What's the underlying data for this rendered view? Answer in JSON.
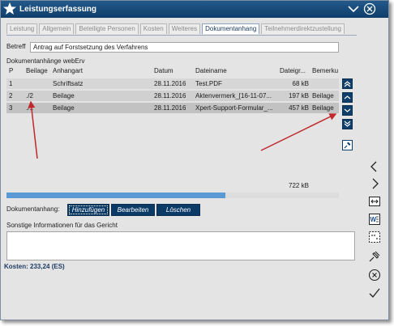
{
  "window": {
    "title": "Leistungserfassung"
  },
  "tabs": [
    {
      "label": "Leistung",
      "active": false
    },
    {
      "label": "Allgemein",
      "active": false
    },
    {
      "label": "Beteiligte Personen",
      "active": false
    },
    {
      "label": "Kosten",
      "active": false
    },
    {
      "label": "Weiteres",
      "active": false
    },
    {
      "label": "Dokumentanhang",
      "active": true
    },
    {
      "label": "Teilnehmerdirektzustellung",
      "active": false
    }
  ],
  "betreff": {
    "label": "Betreff",
    "value": "Antrag auf Forstsetzung des Verfahrens"
  },
  "attachments": {
    "section_title": "Dokumentanhänge webErv",
    "columns": [
      "P",
      "Beilage",
      "Anhangart",
      "Datum",
      "Dateiname",
      "Dateigr...",
      "Bemerku"
    ],
    "rows": [
      {
        "p": "1",
        "beilage": "",
        "anhangart": "Schriftsatz",
        "datum": "28.11.2016",
        "dateiname": "Test.PDF",
        "groesse": "68 kB",
        "bemerkung": ""
      },
      {
        "p": "2",
        "beilage": "./2",
        "anhangart": "Beilage",
        "datum": "28.11.2016",
        "dateiname": "Aktenvermerk_[16-11-07...",
        "groesse": "197 kB",
        "bemerkung": "Beilage"
      },
      {
        "p": "3",
        "beilage": "./1",
        "anhangart": "Beilage",
        "datum": "28.11.2016",
        "dateiname": "Xpert-Support-Formular_...",
        "groesse": "457 kB",
        "bemerkung": "Beilage"
      }
    ],
    "total_size": "722 kB"
  },
  "dokumentanhang": {
    "label": "Dokumentanhang:",
    "buttons": {
      "add": "Hinzufügen",
      "edit": "Bearbeiten",
      "delete": "Löschen"
    }
  },
  "notes": {
    "label": "Sonstige Informationen für das Gericht",
    "value": ""
  },
  "costs": {
    "text": "Kosten: 233,24 (ES)"
  },
  "colors": {
    "titlebar": "#0f3e6b",
    "button": "#0c3a66",
    "scroll_thumb": "#5a9ad4",
    "annotation_arrow": "#c0282c"
  },
  "icons": {
    "title": "star-app-icon",
    "window": [
      "collapse-chevron-icon",
      "close-circle-icon"
    ],
    "grid_side": [
      "move-top-icon",
      "move-up-icon",
      "move-down-icon",
      "move-bottom-icon",
      "pin-icon"
    ],
    "vertical_toolbar": [
      "chevron-left-icon",
      "chevron-right-icon",
      "resize-icon",
      "word-icon",
      "dots-icon",
      "pin-icon",
      "cancel-icon",
      "confirm-icon"
    ]
  }
}
